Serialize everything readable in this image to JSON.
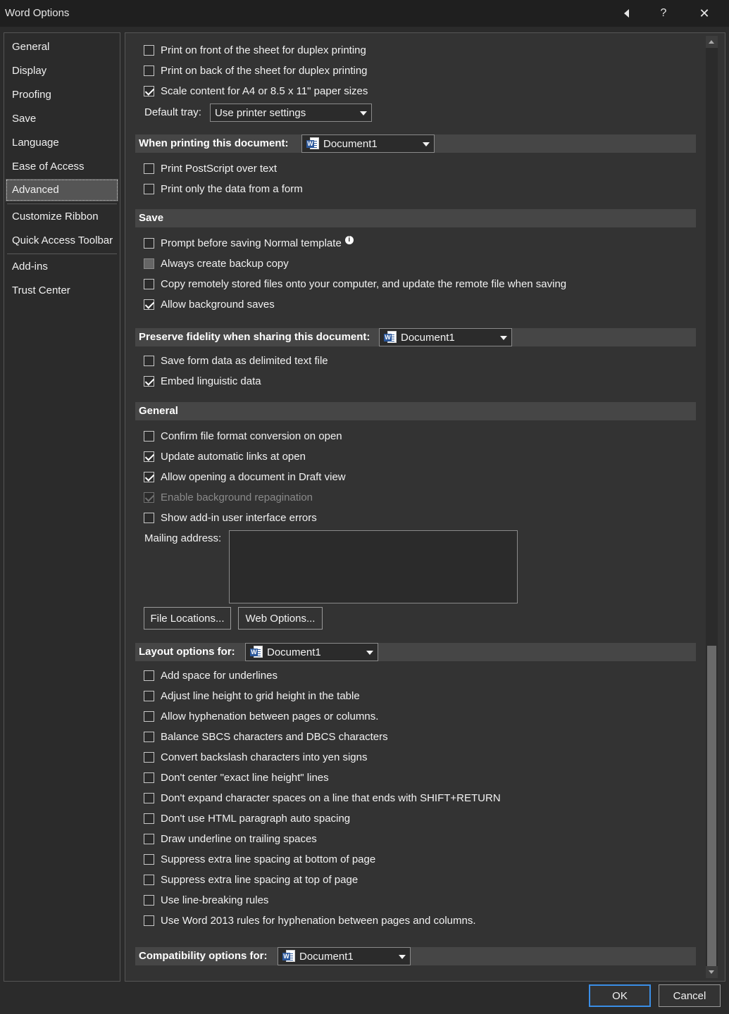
{
  "window": {
    "title": "Word Options",
    "help_label": "?",
    "close_label": "✕"
  },
  "sidebar": {
    "items": [
      {
        "label": "General"
      },
      {
        "label": "Display"
      },
      {
        "label": "Proofing"
      },
      {
        "label": "Save"
      },
      {
        "label": "Language"
      },
      {
        "label": "Ease of Access"
      },
      {
        "label": "Advanced"
      },
      {
        "label": "Customize Ribbon"
      },
      {
        "label": "Quick Access Toolbar"
      },
      {
        "label": "Add-ins"
      },
      {
        "label": "Trust Center"
      }
    ],
    "selected": "Advanced"
  },
  "print": {
    "options": [
      {
        "label": "Print on front of the sheet for duplex printing",
        "checked": false
      },
      {
        "label": "Print on back of the sheet for duplex printing",
        "checked": false
      },
      {
        "label": "Scale content for A4 or 8.5 x 11\" paper sizes",
        "checked": true
      }
    ],
    "default_tray_label": "Default tray:",
    "default_tray_value": "Use printer settings"
  },
  "when_printing": {
    "header": "When printing this document:",
    "document": "Document1",
    "options": [
      {
        "label": "Print PostScript over text",
        "checked": false
      },
      {
        "label": "Print only the data from a form",
        "checked": false
      }
    ]
  },
  "save": {
    "header": "Save",
    "info_icon_glyph": "i",
    "options": [
      {
        "label": "Prompt before saving Normal template",
        "checked": false
      },
      {
        "label": "Always create backup copy",
        "checked": false
      },
      {
        "label": "Copy remotely stored files onto your computer, and update the remote file when saving",
        "checked": false
      },
      {
        "label": "Allow background saves",
        "checked": true
      }
    ]
  },
  "fidelity": {
    "header": "Preserve fidelity when sharing this document:",
    "document": "Document1",
    "options": [
      {
        "label": "Save form data as delimited text file",
        "checked": false
      },
      {
        "label": "Embed linguistic data",
        "checked": true
      }
    ]
  },
  "general": {
    "header": "General",
    "options": [
      {
        "label": "Confirm file format conversion on open",
        "checked": false
      },
      {
        "label": "Update automatic links at open",
        "checked": true
      },
      {
        "label": "Allow opening a document in Draft view",
        "checked": true
      },
      {
        "label": "Enable background repagination",
        "checked": true,
        "disabled": true
      },
      {
        "label": "Show add-in user interface errors",
        "checked": false
      }
    ],
    "mailing_address_label": "Mailing address:",
    "mailing_address_value": "",
    "file_locations_button": "File Locations...",
    "web_options_button": "Web Options..."
  },
  "layout": {
    "header": "Layout options for:",
    "document": "Document1",
    "options": [
      {
        "label": "Add space for underlines",
        "checked": false
      },
      {
        "label": "Adjust line height to grid height in the table",
        "checked": false
      },
      {
        "label": "Allow hyphenation between pages or columns.",
        "checked": false
      },
      {
        "label": "Balance SBCS characters and DBCS characters",
        "checked": false
      },
      {
        "label": "Convert backslash characters into yen signs",
        "checked": false
      },
      {
        "label": "Don't center \"exact line height\" lines",
        "checked": false
      },
      {
        "label": "Don't expand character spaces on a line that ends with SHIFT+RETURN",
        "checked": false
      },
      {
        "label": "Don't use HTML paragraph auto spacing",
        "checked": false
      },
      {
        "label": "Draw underline on trailing spaces",
        "checked": false
      },
      {
        "label": "Suppress extra line spacing at bottom of page",
        "checked": false
      },
      {
        "label": "Suppress extra line spacing at top of page",
        "checked": false
      },
      {
        "label": "Use line-breaking rules",
        "checked": false
      },
      {
        "label": "Use Word 2013 rules for hyphenation between pages and columns.",
        "checked": false
      }
    ]
  },
  "compat": {
    "header": "Compatibility options for:",
    "document": "Document1"
  },
  "footer": {
    "ok_label": "OK",
    "cancel_label": "Cancel"
  },
  "colors": {
    "background": "#2b2b2b",
    "panel": "#333333",
    "section_header": "#464646",
    "selected_nav": "#555555",
    "primary_button_border": "#3a8ee6",
    "word_icon": "#2b579a"
  }
}
